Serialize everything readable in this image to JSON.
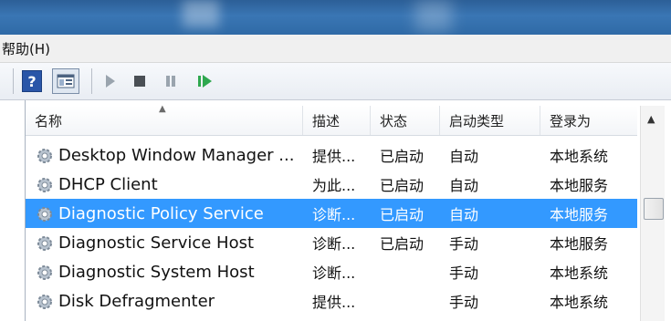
{
  "menu": {
    "help_label": "帮助(H)"
  },
  "toolbar": {
    "help_glyph": "?",
    "play_glyph": "▶",
    "stop_glyph": "■",
    "pause_glyph": "❚❚",
    "resume_glyph": "▶"
  },
  "columns": {
    "name": "名称",
    "description": "描述",
    "status": "状态",
    "startup_type": "启动类型",
    "logon_as": "登录为"
  },
  "services": [
    {
      "name": "Desktop Window Manager ...",
      "description": "提供...",
      "status": "已启动",
      "startup_type": "自动",
      "logon_as": "本地系统"
    },
    {
      "name": "DHCP Client",
      "description": "为此...",
      "status": "已启动",
      "startup_type": "自动",
      "logon_as": "本地服务"
    },
    {
      "name": "Diagnostic Policy Service",
      "description": "诊断...",
      "status": "已启动",
      "startup_type": "自动",
      "logon_as": "本地服务"
    },
    {
      "name": "Diagnostic Service Host",
      "description": "诊断...",
      "status": "已启动",
      "startup_type": "手动",
      "logon_as": "本地服务"
    },
    {
      "name": "Diagnostic System Host",
      "description": "诊断...",
      "status": "",
      "startup_type": "手动",
      "logon_as": "本地系统"
    },
    {
      "name": "Disk Defragmenter",
      "description": "提供...",
      "status": "",
      "startup_type": "手动",
      "logon_as": "本地系统"
    }
  ],
  "colors": {
    "selection": "#3399ff",
    "titlebar": "#3a76b4",
    "toolbar_green": "#2fa84f"
  },
  "icons": {
    "service": "gear-icon",
    "help": "help-icon",
    "console": "console-tree-icon"
  }
}
